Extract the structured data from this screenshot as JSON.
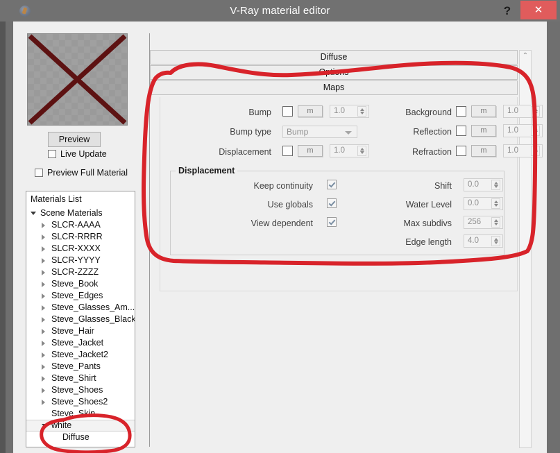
{
  "window": {
    "title": "V-Ray material editor",
    "help_label": "?",
    "close_label": "✕",
    "app_icon": "vray-app-icon"
  },
  "left_panel": {
    "preview_button": "Preview",
    "checkboxes": [
      {
        "label": "Live Update",
        "checked": false
      },
      {
        "label": "Preview Full Material",
        "checked": false
      }
    ],
    "materials_list": {
      "title": "Materials List",
      "nodes": [
        {
          "label": "Scene Materials",
          "level": 0,
          "state": "expanded",
          "selected": false
        },
        {
          "label": "SLCR-AAAA",
          "level": 1,
          "state": "collapsed",
          "selected": false
        },
        {
          "label": "SLCR-RRRR",
          "level": 1,
          "state": "collapsed",
          "selected": false
        },
        {
          "label": "SLCR-XXXX",
          "level": 1,
          "state": "collapsed",
          "selected": false
        },
        {
          "label": "SLCR-YYYY",
          "level": 1,
          "state": "collapsed",
          "selected": false
        },
        {
          "label": "SLCR-ZZZZ",
          "level": 1,
          "state": "collapsed",
          "selected": false
        },
        {
          "label": "Steve_Book",
          "level": 1,
          "state": "collapsed",
          "selected": false
        },
        {
          "label": "Steve_Edges",
          "level": 1,
          "state": "collapsed",
          "selected": false
        },
        {
          "label": "Steve_Glasses_Am...",
          "level": 1,
          "state": "collapsed",
          "selected": false
        },
        {
          "label": "Steve_Glasses_Black",
          "level": 1,
          "state": "collapsed",
          "selected": false
        },
        {
          "label": "Steve_Hair",
          "level": 1,
          "state": "collapsed",
          "selected": false
        },
        {
          "label": "Steve_Jacket",
          "level": 1,
          "state": "collapsed",
          "selected": false
        },
        {
          "label": "Steve_Jacket2",
          "level": 1,
          "state": "collapsed",
          "selected": false
        },
        {
          "label": "Steve_Pants",
          "level": 1,
          "state": "collapsed",
          "selected": false
        },
        {
          "label": "Steve_Shirt",
          "level": 1,
          "state": "collapsed",
          "selected": false
        },
        {
          "label": "Steve_Shoes",
          "level": 1,
          "state": "collapsed",
          "selected": false
        },
        {
          "label": "Steve_Shoes2",
          "level": 1,
          "state": "collapsed",
          "selected": false
        },
        {
          "label": "Steve_Skin",
          "level": 1,
          "state": "none",
          "selected": false
        },
        {
          "label": "white",
          "level": 1,
          "state": "expanded",
          "selected": true
        },
        {
          "label": "Diffuse",
          "level": 2,
          "state": "none",
          "selected": false
        }
      ]
    }
  },
  "rollouts": [
    {
      "label": "Diffuse",
      "expanded": false
    },
    {
      "label": "Options",
      "expanded": false
    },
    {
      "label": "Maps",
      "expanded": true
    }
  ],
  "maps": {
    "left_rows": [
      {
        "label": "Bump",
        "checked": false,
        "map_button": "m",
        "value": "1.0"
      },
      {
        "label": "Displacement",
        "checked": false,
        "map_button": "m",
        "value": "1.0"
      }
    ],
    "bump_type": {
      "label": "Bump type",
      "value": "Bump"
    },
    "right_rows": [
      {
        "label": "Background",
        "checked": false,
        "map_button": "m",
        "value": "1.0"
      },
      {
        "label": "Reflection",
        "checked": false,
        "map_button": "m",
        "value": "1.0"
      },
      {
        "label": "Refraction",
        "checked": false,
        "map_button": "m",
        "value": "1.0"
      }
    ]
  },
  "displacement": {
    "title": "Displacement",
    "checkboxes": [
      {
        "label": "Keep continuity",
        "checked": true
      },
      {
        "label": "Use globals",
        "checked": true
      },
      {
        "label": "View dependent",
        "checked": true
      }
    ],
    "fields": [
      {
        "label": "Shift",
        "value": "0.0"
      },
      {
        "label": "Water Level",
        "value": "0.0"
      },
      {
        "label": "Max subdivs",
        "value": "256"
      },
      {
        "label": "Edge length",
        "value": "4.0"
      }
    ]
  },
  "scrollbar": {
    "up_arrow": "⌃"
  },
  "annotation": {
    "color": "#d8232a",
    "shapes": [
      "large-loop-around-maps-panel",
      "small-loop-around-white-diffuse"
    ]
  },
  "colors": {
    "titlebar": "#717171",
    "close_button": "#e05c5c",
    "client_background": "#efefef",
    "annotation_red": "#d8232a"
  }
}
